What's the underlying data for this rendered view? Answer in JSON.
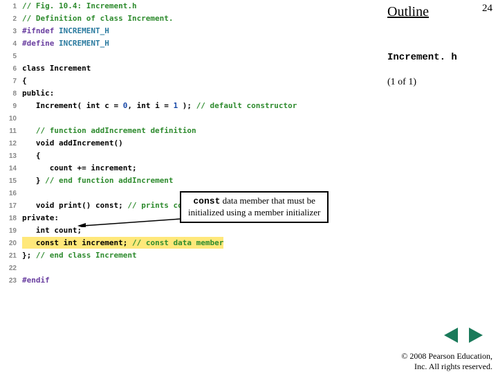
{
  "slide": {
    "outline_label": "Outline",
    "page_number": "24",
    "filename": "Increment. h",
    "page_of": "(1 of 1)"
  },
  "code": {
    "lines": [
      {
        "n": "1",
        "segs": [
          {
            "c": "comment",
            "t": "// Fig. 10.4: Increment.h"
          }
        ]
      },
      {
        "n": "2",
        "segs": [
          {
            "c": "comment",
            "t": "// Definition of class Increment."
          }
        ]
      },
      {
        "n": "3",
        "segs": [
          {
            "c": "preproc",
            "t": "#ifndef "
          },
          {
            "c": "macro",
            "t": "INCREMENT_H"
          }
        ]
      },
      {
        "n": "4",
        "segs": [
          {
            "c": "preproc",
            "t": "#define "
          },
          {
            "c": "macro",
            "t": "INCREMENT_H"
          }
        ]
      },
      {
        "n": "5",
        "segs": []
      },
      {
        "n": "6",
        "segs": [
          {
            "c": "keyword",
            "t": "class Increment"
          }
        ]
      },
      {
        "n": "7",
        "segs": [
          {
            "c": "keyword",
            "t": "{"
          }
        ]
      },
      {
        "n": "8",
        "segs": [
          {
            "c": "keyword",
            "t": "public:"
          }
        ]
      },
      {
        "n": "9",
        "segs": [
          {
            "c": "keyword",
            "t": "   Increment( int c = "
          },
          {
            "c": "num",
            "t": "0"
          },
          {
            "c": "keyword",
            "t": ", int i = "
          },
          {
            "c": "num",
            "t": "1"
          },
          {
            "c": "keyword",
            "t": " ); "
          },
          {
            "c": "comment",
            "t": "// default constructor"
          }
        ]
      },
      {
        "n": "10",
        "segs": []
      },
      {
        "n": "11",
        "segs": [
          {
            "c": "keyword",
            "t": "   "
          },
          {
            "c": "comment",
            "t": "// function addIncrement definition"
          }
        ]
      },
      {
        "n": "12",
        "segs": [
          {
            "c": "keyword",
            "t": "   void addIncrement()"
          }
        ]
      },
      {
        "n": "13",
        "segs": [
          {
            "c": "keyword",
            "t": "   {"
          }
        ]
      },
      {
        "n": "14",
        "segs": [
          {
            "c": "keyword",
            "t": "      count += increment;"
          }
        ]
      },
      {
        "n": "15",
        "segs": [
          {
            "c": "keyword",
            "t": "   } "
          },
          {
            "c": "comment",
            "t": "// end function addIncrement"
          }
        ]
      },
      {
        "n": "16",
        "segs": []
      },
      {
        "n": "17",
        "segs": [
          {
            "c": "keyword",
            "t": "   void print() const; "
          },
          {
            "c": "comment",
            "t": "// prints count and increment"
          }
        ]
      },
      {
        "n": "18",
        "segs": [
          {
            "c": "keyword",
            "t": "private:"
          }
        ]
      },
      {
        "n": "19",
        "segs": [
          {
            "c": "keyword",
            "t": "   int count;"
          }
        ]
      },
      {
        "n": "20",
        "hl": true,
        "segs": [
          {
            "c": "keyword",
            "t": "   const int increment; "
          },
          {
            "c": "comment",
            "t": "// const data member"
          }
        ]
      },
      {
        "n": "21",
        "segs": [
          {
            "c": "keyword",
            "t": "}; "
          },
          {
            "c": "comment",
            "t": "// end class Increment"
          }
        ]
      },
      {
        "n": "22",
        "segs": []
      },
      {
        "n": "23",
        "segs": [
          {
            "c": "preproc",
            "t": "#endif"
          }
        ]
      }
    ]
  },
  "callout": {
    "keyword": "const",
    "text_line1": " data member that must be",
    "text_line2": "initialized using a member initializer"
  },
  "footer": {
    "line1": "© 2008 Pearson Education,",
    "line2": "Inc. All rights reserved."
  }
}
